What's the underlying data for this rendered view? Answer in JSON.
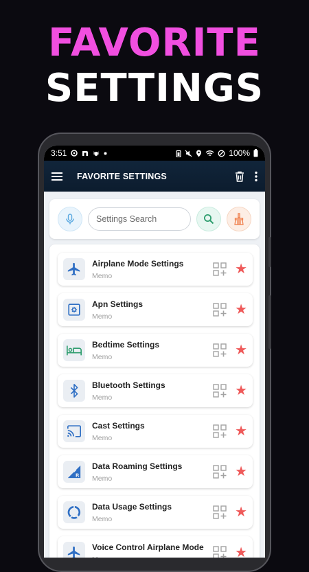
{
  "headline": {
    "line1": "FAVORITE",
    "line2": "SETTINGS"
  },
  "status_bar": {
    "time": "3:51",
    "battery": "100%"
  },
  "appbar": {
    "title": "FAVORITE SETTINGS"
  },
  "search": {
    "placeholder": "Settings Search"
  },
  "list": {
    "items": [
      {
        "name": "Airplane Mode Settings",
        "memo": "Memo",
        "icon": "airplane-icon"
      },
      {
        "name": "Apn Settings",
        "memo": "Memo",
        "icon": "apn-gear-icon"
      },
      {
        "name": "Bedtime Settings",
        "memo": "Memo",
        "icon": "bed-icon"
      },
      {
        "name": "Bluetooth Settings",
        "memo": "Memo",
        "icon": "bluetooth-icon"
      },
      {
        "name": "Cast Settings",
        "memo": "Memo",
        "icon": "cast-icon"
      },
      {
        "name": "Data Roaming Settings",
        "memo": "Memo",
        "icon": "data-roaming-icon"
      },
      {
        "name": "Data Usage Settings",
        "memo": "Memo",
        "icon": "data-usage-icon"
      },
      {
        "name": "Voice Control Airplane Mode",
        "memo": "Memo",
        "icon": "voice-airplane-icon"
      }
    ]
  },
  "colors": {
    "headline_pink": "#f14fe0",
    "appbar": "#11253a",
    "star": "#ef5a5a",
    "icon_blue": "#2f6fc4",
    "icon_green": "#2f9e6f"
  }
}
